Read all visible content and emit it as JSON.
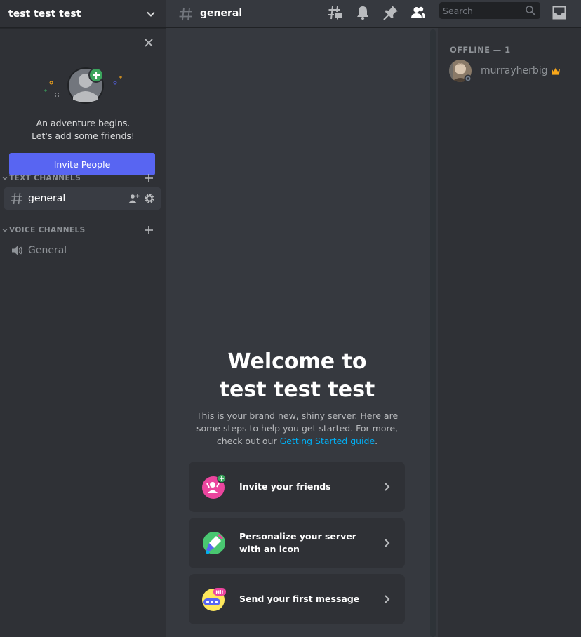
{
  "server": {
    "name": "test test test"
  },
  "invite": {
    "line1": "An adventure begins.",
    "line2": "Let's add some friends!",
    "button": "Invite People"
  },
  "categories": {
    "text": "TEXT CHANNELS",
    "voice": "VOICE CHANNELS"
  },
  "channels": {
    "text": [
      {
        "name": "general"
      }
    ],
    "voice": [
      {
        "name": "General"
      }
    ]
  },
  "topbar": {
    "channel": "general",
    "search_placeholder": "Search"
  },
  "welcome": {
    "title_line1": "Welcome to",
    "title_line2": "test test test",
    "sub_part1": "This is your brand new, shiny server. Here are some steps to help you get started. For more, check out our",
    "link": "Getting Started guide",
    "sub_end": "."
  },
  "actions": [
    {
      "label": "Invite your friends",
      "icon": "invite-friends-icon",
      "color": "#eb459e"
    },
    {
      "label": "Personalize your server with an icon",
      "icon": "personalize-icon",
      "color": "#57f287"
    },
    {
      "label": "Send your first message",
      "icon": "message-icon",
      "color": "#fee75c"
    }
  ],
  "members": {
    "heading": "OFFLINE — 1",
    "list": [
      {
        "name": "murrayherbig",
        "owner": true
      }
    ]
  },
  "colors": {
    "accent": "#5865f2",
    "link": "#00aff4",
    "crown": "#faa81a",
    "sidebar_bg": "#2f3136",
    "main_bg": "#36393f"
  }
}
